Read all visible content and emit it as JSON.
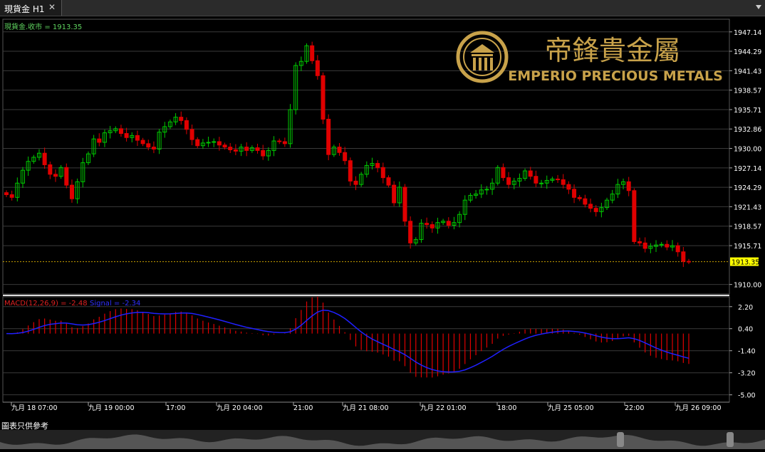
{
  "tab": {
    "title": "現貨金 H1"
  },
  "symbol_label": "現貨金.收市 = 1913.35",
  "macd_label_main": "MACD(12,26,9) = -2.48",
  "macd_label_signal": "Signal = -2.34",
  "logo": {
    "cn": "帝鋒貴金屬",
    "en": "EMPERIO PRECIOUS METALS"
  },
  "footer": {
    "disclaimer": "圖表只供參考"
  },
  "colors": {
    "up": "#00c800",
    "down": "#e00000",
    "grid": "#3a3a3a",
    "signal": "#2020ff",
    "last_price_bg": "#ffff00",
    "gold": "#c8a24a"
  },
  "chart_data": [
    {
      "type": "candlestick",
      "title": "現貨金 H1",
      "y_ticks": [
        "1947.14",
        "1944.29",
        "1941.43",
        "1938.57",
        "1935.71",
        "1932.86",
        "1930.00",
        "1927.14",
        "1924.29",
        "1921.43",
        "1918.57",
        "1915.71",
        "1913.35",
        "1910.00"
      ],
      "ylim": [
        1908.6,
        1949.0
      ],
      "last_price": 1913.35,
      "x_ticks": [
        "九月 18 07:00",
        "九月 19 00:00",
        "17:00",
        "九月 20 04:00",
        "21:00",
        "九月 21 08:00",
        "九月 22 01:00",
        "18:00",
        "九月 25 05:00",
        "22:00",
        "九月 26 09:00"
      ],
      "closes": [
        1923.2,
        1922.8,
        1924.9,
        1926.8,
        1928.1,
        1928.7,
        1929.3,
        1927.6,
        1926.2,
        1925.9,
        1927.2,
        1924.6,
        1922.6,
        1925.1,
        1927.9,
        1929.2,
        1931.4,
        1930.9,
        1932.3,
        1932.6,
        1932.9,
        1932.2,
        1931.6,
        1931.9,
        1931.2,
        1930.7,
        1930.2,
        1929.9,
        1932.4,
        1933.2,
        1933.9,
        1934.6,
        1934.1,
        1932.8,
        1931.3,
        1930.4,
        1930.8,
        1930.9,
        1931.0,
        1930.5,
        1930.2,
        1929.8,
        1929.6,
        1930.2,
        1929.7,
        1930.1,
        1929.7,
        1928.9,
        1929.7,
        1931.1,
        1931.0,
        1930.7,
        1935.7,
        1942.2,
        1942.8,
        1945.1,
        1942.9,
        1940.7,
        1934.3,
        1929.1,
        1930.2,
        1929.4,
        1928.2,
        1925.2,
        1924.7,
        1926.2,
        1927.5,
        1927.8,
        1927.2,
        1925.7,
        1924.6,
        1922.0,
        1924.3,
        1919.3,
        1916.1,
        1916.6,
        1919.0,
        1918.8,
        1918.3,
        1919.1,
        1919.3,
        1918.7,
        1919.1,
        1920.3,
        1922.4,
        1923.1,
        1923.3,
        1923.9,
        1924.0,
        1924.9,
        1927.2,
        1925.7,
        1924.7,
        1925.2,
        1925.6,
        1926.7,
        1925.9,
        1924.9,
        1924.9,
        1925.3,
        1925.5,
        1925.4,
        1924.7,
        1924.0,
        1922.8,
        1922.6,
        1921.8,
        1921.2,
        1920.7,
        1921.3,
        1922.4,
        1923.3,
        1924.7,
        1925.1,
        1923.8,
        1916.3,
        1916.1,
        1915.3,
        1915.6,
        1915.8,
        1915.9,
        1915.5,
        1915.7,
        1914.8,
        1913.4,
        1913.35
      ],
      "macd_ylim": [
        -5.6,
        3.0
      ],
      "macd_ticks": [
        "2.20",
        "0.40",
        "-1.40",
        "-3.20",
        "-5.00"
      ],
      "macd_main": -2.48,
      "macd_signal": -2.34
    }
  ]
}
